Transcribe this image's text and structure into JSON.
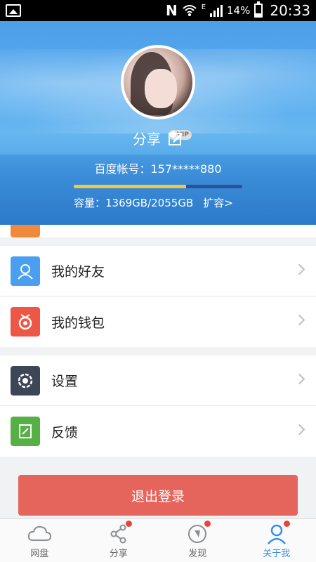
{
  "status_bar": {
    "battery_percent": "14%",
    "time": "20:33",
    "network_letter": "E",
    "notification_letter": "N"
  },
  "profile": {
    "username": "分享",
    "account_label": "百度帐号：157*****880",
    "vip_badge": "VIP",
    "storage_used_fraction": 0.666,
    "capacity_text": "容量：1369GB/2055GB",
    "expand_link": "扩容>"
  },
  "menu": {
    "group1": [
      {
        "label": "我的好友",
        "icon": "friends-icon",
        "color": "#4a9ff0"
      },
      {
        "label": "我的钱包",
        "icon": "wallet-icon",
        "color": "#ec5746"
      }
    ],
    "group2": [
      {
        "label": "设置",
        "icon": "settings-icon",
        "color": "#3c4657"
      },
      {
        "label": "反馈",
        "icon": "feedback-icon",
        "color": "#57b046"
      }
    ]
  },
  "logout": {
    "label": "退出登录",
    "color": "#e5645b"
  },
  "bottom_nav": [
    {
      "label": "网盘",
      "icon": "cloud-icon",
      "badge": false,
      "active": false
    },
    {
      "label": "分享",
      "icon": "share-icon",
      "badge": true,
      "active": false
    },
    {
      "label": "发现",
      "icon": "compass-icon",
      "badge": true,
      "active": false
    },
    {
      "label": "关于我",
      "icon": "user-icon",
      "badge": true,
      "active": true
    }
  ],
  "colors": {
    "accent": "#3a8ee6",
    "badge": "#e8443f",
    "storage_fill": "#f2c744",
    "storage_track": "#2d4f9e"
  }
}
